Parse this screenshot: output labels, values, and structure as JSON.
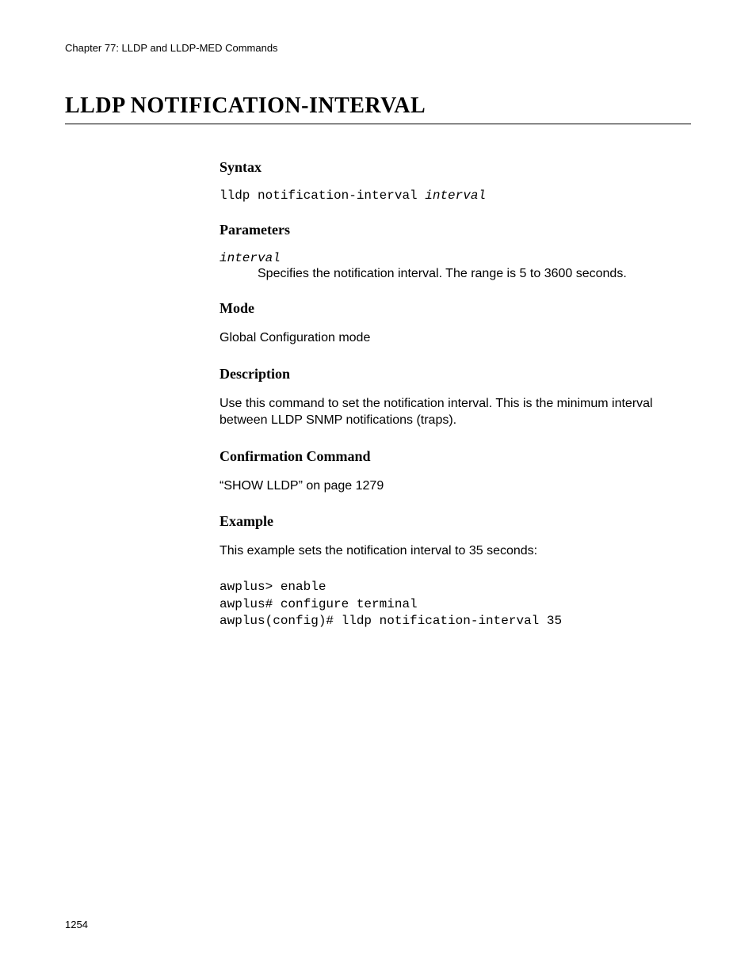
{
  "header": {
    "chapter": "Chapter 77: LLDP and LLDP-MED Commands"
  },
  "title": "LLDP NOTIFICATION-INTERVAL",
  "sections": {
    "syntax": {
      "heading": "Syntax",
      "command": "lldp notification-interval ",
      "param": "interval"
    },
    "parameters": {
      "heading": "Parameters",
      "param_name": "interval",
      "param_desc": "Specifies the notification interval. The range is 5 to 3600 seconds."
    },
    "mode": {
      "heading": "Mode",
      "text": "Global Configuration mode"
    },
    "description": {
      "heading": "Description",
      "text": "Use this command to set the notification interval. This is the minimum interval between LLDP SNMP notifications (traps)."
    },
    "confirmation": {
      "heading": "Confirmation Command",
      "text": "“SHOW LLDP” on page 1279"
    },
    "example": {
      "heading": "Example",
      "intro": "This example sets the notification interval to 35 seconds:",
      "code": "awplus> enable\nawplus# configure terminal\nawplus(config)# lldp notification-interval 35"
    }
  },
  "page_number": "1254"
}
